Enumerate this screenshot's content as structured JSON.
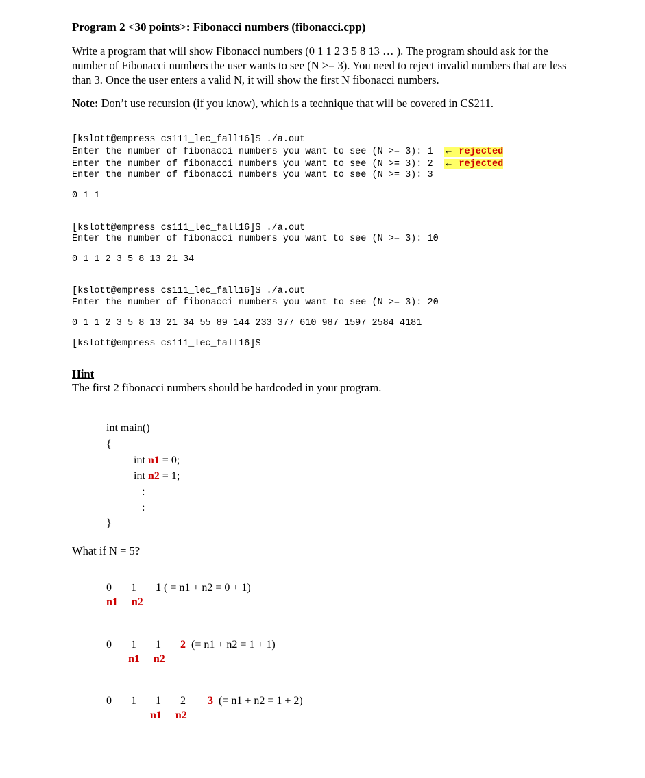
{
  "title": "Program 2 <30 points>: Fibonacci numbers (fibonacci.cpp)",
  "body": "Write a program that will show Fibonacci numbers (0 1 1 2 3 5 8 13 … ). The program should ask for the number of Fibonacci numbers the user wants to see (N >= 3).  You need to reject invalid numbers that are less than 3. Once the user enters a valid N, it will show the first N fibonacci numbers.",
  "note_label": "Note:",
  "note_text": " Don’t use recursion (if you know), which is a technique that will be covered in CS211.",
  "term": {
    "prompt1": "[kslott@empress cs111_lec_fall16]$ ./a.out",
    "line1a": "Enter the number of fibonacci numbers you want to see (N >= 3): 1  ",
    "line1b": "Enter the number of fibonacci numbers you want to see (N >= 3): 2  ",
    "rej": "rejected",
    "arrow": "←",
    "line1c": "Enter the number of fibonacci numbers you want to see (N >= 3): 3",
    "out1": "0 1 1",
    "prompt2": "[kslott@empress cs111_lec_fall16]$ ./a.out",
    "line2": "Enter the number of fibonacci numbers you want to see (N >= 3): 10",
    "out2": "0 1 1 2 3 5 8 13 21 34",
    "prompt3": "[kslott@empress cs111_lec_fall16]$ ./a.out",
    "line3": "Enter the number of fibonacci numbers you want to see (N >= 3): 20",
    "out3": "0 1 1 2 3 5 8 13 21 34 55 89 144 233 377 610 987 1597 2584 4181",
    "prompt4": "[kslott@empress cs111_lec_fall16]$"
  },
  "hint_heading": "Hint",
  "hint_text": "The first 2 fibonacci numbers should be hardcoded in your program.",
  "snippet": {
    "l1": "int main()",
    "l2": "{",
    "l3a": "          int ",
    "l3b": "n1",
    "l3c": " = 0;",
    "l4a": "          int ",
    "l4b": "n2",
    "l4c": " = 1;",
    "l5": "             :",
    "l6": "             :",
    "l7": "}"
  },
  "whatif": "What if N = 5?",
  "ex1": {
    "row1_a": "0",
    "row1_b": "1",
    "row1_c": "1",
    "row1_note": " ( = n1 + n2 = 0 + 1)",
    "row2_a": "n1",
    "row2_b": "n2"
  },
  "ex2": {
    "row1_a": "0",
    "row1_b": "1",
    "row1_c": "1",
    "row1_d": "2",
    "row1_note": "  (= n1 + n2 = 1 + 1)",
    "row2_b": "n1",
    "row2_c": "n2"
  },
  "ex3": {
    "row1_a": "0",
    "row1_b": "1",
    "row1_c": "1",
    "row1_d": "2",
    "row1_e": "3",
    "row1_note": "  (= n1 + n2 = 1 + 2)",
    "row2_c": "n1",
    "row2_d": "n2"
  }
}
